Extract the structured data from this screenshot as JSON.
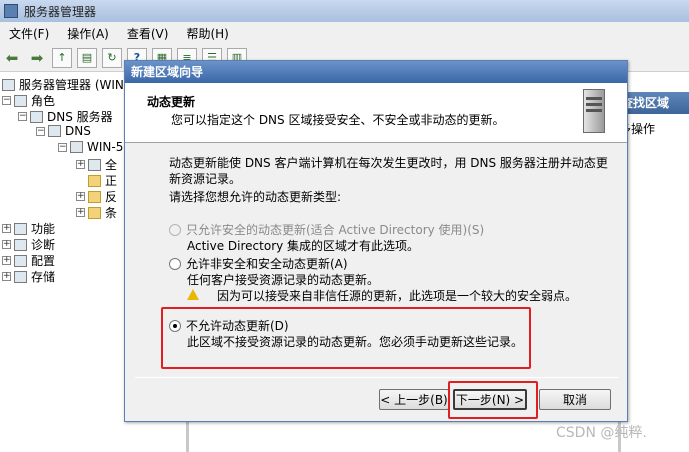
{
  "window": {
    "title": "服务器管理器"
  },
  "menu": [
    "文件(F)",
    "操作(A)",
    "查看(V)",
    "帮助(H)"
  ],
  "tree": {
    "root": "服务器管理器 (WIN-",
    "roles": "角色",
    "dns_server": "DNS 服务器",
    "dns": "DNS",
    "win": "WIN-5",
    "items": [
      "全",
      "正",
      "反",
      "条"
    ],
    "features": "功能",
    "diagnostics": "诊断",
    "config": "配置",
    "storage": "存储"
  },
  "right_pane": {
    "header": "查找区域",
    "link": "多操作"
  },
  "dialog": {
    "title": "新建区域向导",
    "header_title": "动态更新",
    "header_subtitle": "您可以指定这个 DNS 区域接受安全、不安全或非动态的更新。",
    "intro_line1": "动态更新能使 DNS 客户端计算机在每次发生更改时，用 DNS 服务器注册并动态更",
    "intro_line2": "新资源记录。",
    "prompt": "请选择您想允许的动态更新类型:",
    "options": [
      {
        "label": "只允许安全的动态更新(适合 Active Directory 使用)(S)",
        "desc": "Active Directory 集成的区域才有此选项。"
      },
      {
        "label": "允许非安全和安全动态更新(A)",
        "desc": "任何客户接受资源记录的动态更新。",
        "warning": "因为可以接受来自非信任源的更新，此选项是一个较大的安全弱点。"
      },
      {
        "label": "不允许动态更新(D)",
        "desc": "此区域不接受资源记录的动态更新。您必须手动更新这些记录。"
      }
    ],
    "buttons": {
      "back": "< 上一步(B)",
      "next": "下一步(N) >",
      "cancel": "取消"
    }
  },
  "watermark": "CSDN @纯粹."
}
